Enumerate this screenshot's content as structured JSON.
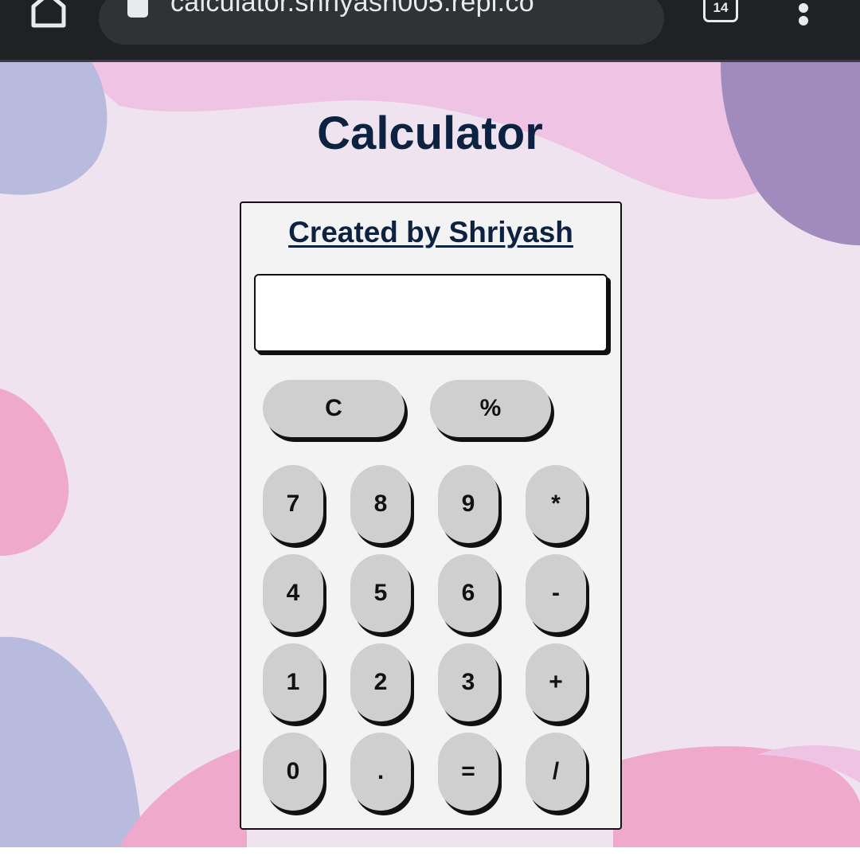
{
  "browser": {
    "url": "calculator.shriyash005.repl.co",
    "tab_count": "14"
  },
  "page": {
    "title": "Calculator"
  },
  "calculator": {
    "credit": "Created by Shriyash",
    "display_value": "",
    "top_keys": [
      "C",
      "%"
    ],
    "keypad_rows": [
      [
        "7",
        "8",
        "9",
        "*"
      ],
      [
        "4",
        "5",
        "6",
        "-"
      ],
      [
        "1",
        "2",
        "3",
        "+"
      ],
      [
        "0",
        ".",
        "=",
        "/"
      ]
    ]
  },
  "colors": {
    "title": "#0d2240",
    "key": "#cfcfcf",
    "card": "#f3f3f4",
    "page_background": "#efe3ef",
    "browser_bar": "#1f2124"
  },
  "icons": {
    "home": "home-icon",
    "lock": "lock-icon",
    "tabs": "tab-switcher-icon",
    "menu": "more-vert-icon"
  }
}
